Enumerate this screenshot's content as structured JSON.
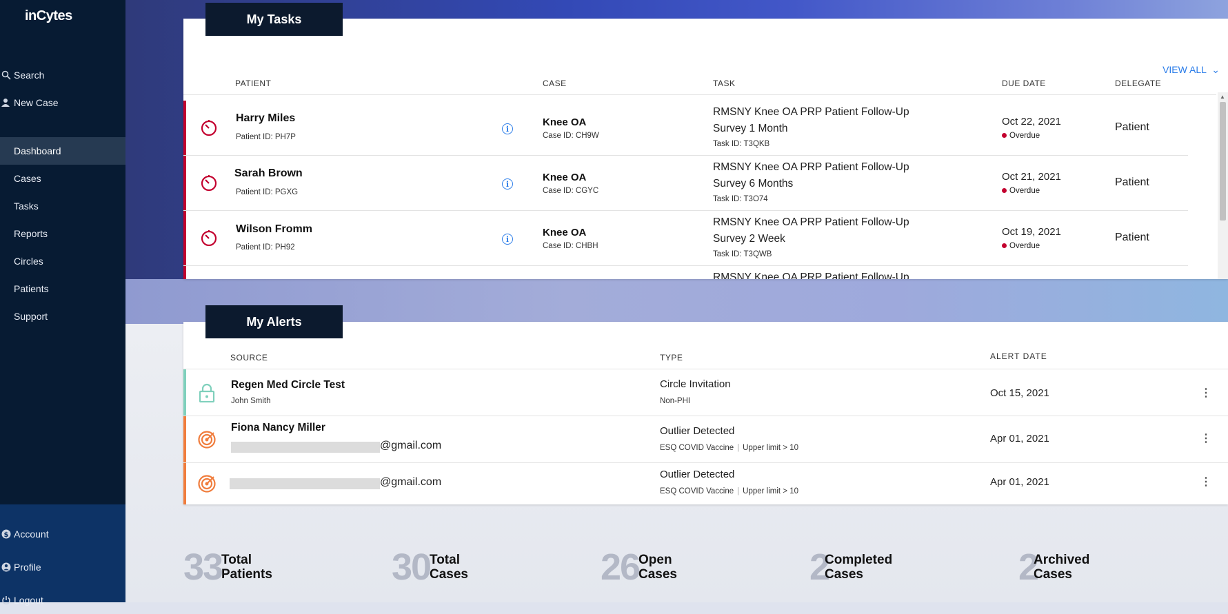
{
  "brand": {
    "logo": "inCytes"
  },
  "sidebar": {
    "top_items": [
      {
        "label": "Search",
        "icon": "search-icon"
      },
      {
        "label": "New Case",
        "icon": "person-add-icon"
      }
    ],
    "items": [
      {
        "label": "Dashboard",
        "active": true
      },
      {
        "label": "Cases"
      },
      {
        "label": "Tasks"
      },
      {
        "label": "Reports"
      },
      {
        "label": "Circles"
      },
      {
        "label": "Patients"
      },
      {
        "label": "Support"
      }
    ],
    "bottom_items": [
      {
        "label": "Account",
        "icon": "dollar-icon"
      },
      {
        "label": "Profile",
        "icon": "user-icon"
      },
      {
        "label": "Logout",
        "icon": "power-icon"
      }
    ]
  },
  "tasks": {
    "title": "My Tasks",
    "view_all": "VIEW ALL",
    "columns": {
      "patient": "PATIENT",
      "case": "CASE",
      "task": "TASK",
      "due": "DUE DATE",
      "delegate": "DELEGATE"
    },
    "rows": [
      {
        "name": "Harry Miles",
        "pid": "Patient ID: PH7P",
        "case": "Knee OA",
        "cid": "Case ID: CH9W",
        "task": "RMSNY Knee OA PRP Patient Follow-Up Survey 1 Month",
        "tid": "Task ID: T3QKB",
        "due": "Oct 22, 2021",
        "status": "Overdue",
        "delegate": "Patient"
      },
      {
        "name": "Sarah Brown",
        "pid": "Patient ID: PGXG",
        "case": "Knee OA",
        "cid": "Case ID: CGYC",
        "task": "RMSNY Knee OA PRP Patient Follow-Up Survey 6 Months",
        "tid": "Task ID: T3O74",
        "due": "Oct 21, 2021",
        "status": "Overdue",
        "delegate": "Patient"
      },
      {
        "name": "Wilson Fromm",
        "pid": "Patient ID: PH92",
        "case": "Knee OA",
        "cid": "Case ID: CHBH",
        "task": "RMSNY Knee OA PRP Patient Follow-Up Survey 2 Week",
        "tid": "Task ID: T3QWB",
        "due": "Oct 19, 2021",
        "status": "Overdue",
        "delegate": "Patient"
      },
      {
        "task": "RMSNY Knee OA PRP Patient Follow-Up"
      }
    ]
  },
  "alerts": {
    "title": "My Alerts",
    "columns": {
      "source": "SOURCE",
      "type": "TYPE",
      "date": "ALERT DATE"
    },
    "rows": [
      {
        "source": "Regen Med Circle Test",
        "source_sub": "John Smith",
        "type": "Circle Invitation",
        "type_sub": "Non-PHI",
        "date": "Oct 15, 2021",
        "icon": "lock-icon",
        "color": "#7fd0bc"
      },
      {
        "source": "Fiona Nancy Miller",
        "email": "@gmail.com",
        "type": "Outlier Detected",
        "type_sub_a": "ESQ COVID Vaccine",
        "type_sub_b": "Upper limit > 10",
        "date": "Apr 01, 2021",
        "icon": "target-icon",
        "color": "#f07d3d"
      },
      {
        "email": "@gmail.com",
        "type": "Outlier Detected",
        "type_sub_a": "ESQ COVID Vaccine",
        "type_sub_b": "Upper limit > 10",
        "date": "Apr 01, 2021",
        "icon": "target-icon",
        "color": "#f07d3d"
      }
    ]
  },
  "stats": [
    {
      "value": "33",
      "line1": "Total",
      "line2": "Patients"
    },
    {
      "value": "30",
      "line1": "Total",
      "line2": "Cases"
    },
    {
      "value": "26",
      "line1": "Open",
      "line2": "Cases"
    },
    {
      "value": "2",
      "line1": "Completed",
      "line2": "Cases"
    },
    {
      "value": "2",
      "line1": "Archived",
      "line2": "Cases"
    }
  ],
  "colors": {
    "sidebar": "#071b33",
    "accent": "#2b7de9",
    "overdue": "#c3002f",
    "title_bg": "#0c1a2e"
  }
}
